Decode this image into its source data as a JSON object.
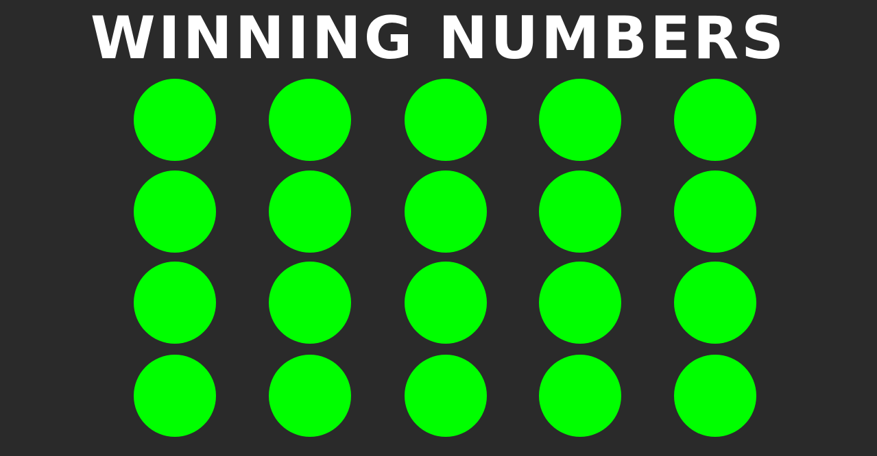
{
  "title": "Winning Numbers",
  "ball_color": "#00ff00",
  "background_color": "#2a2a2a",
  "rows": 4,
  "columns": 5,
  "balls": [
    {
      "number": ""
    },
    {
      "number": ""
    },
    {
      "number": ""
    },
    {
      "number": ""
    },
    {
      "number": ""
    },
    {
      "number": ""
    },
    {
      "number": ""
    },
    {
      "number": ""
    },
    {
      "number": ""
    },
    {
      "number": ""
    },
    {
      "number": ""
    },
    {
      "number": ""
    },
    {
      "number": ""
    },
    {
      "number": ""
    },
    {
      "number": ""
    },
    {
      "number": ""
    },
    {
      "number": ""
    },
    {
      "number": ""
    },
    {
      "number": ""
    },
    {
      "number": ""
    }
  ]
}
